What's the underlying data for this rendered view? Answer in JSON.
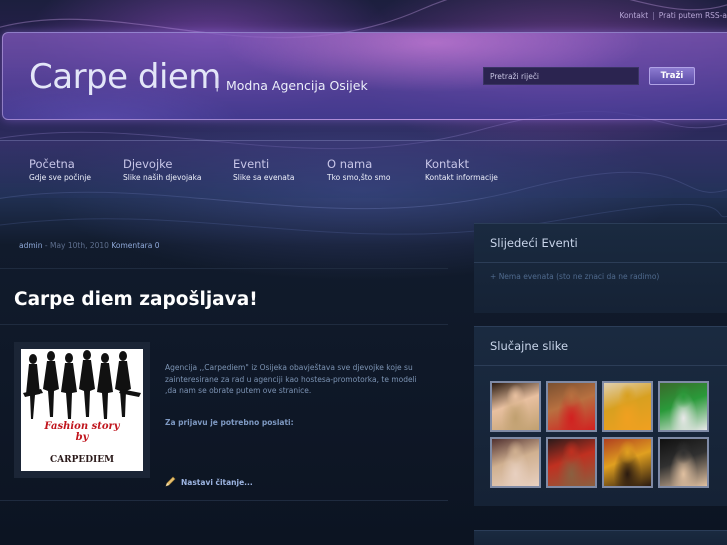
{
  "top_links": {
    "contact": "Kontakt",
    "separator": "|",
    "rss": "Prati putem RSS-a"
  },
  "header": {
    "title": "Carpe diem",
    "separator": "|",
    "subtitle": "Modna Agencija Osijek",
    "search_placeholder": "Pretraži riječi",
    "search_button": "Traži"
  },
  "nav": [
    {
      "title": "Početna",
      "subtitle": "Gdje sve počinje"
    },
    {
      "title": "Djevojke",
      "subtitle": "Slike naših djevojaka"
    },
    {
      "title": "Eventi",
      "subtitle": "Slike sa evenata"
    },
    {
      "title": "O nama",
      "subtitle": "Tko smo,što smo"
    },
    {
      "title": "Kontakt",
      "subtitle": "Kontakt informacije"
    }
  ],
  "post": {
    "author": "admin",
    "date": " - May 10th, 2010 ",
    "comments": "Komentara 0",
    "title": "Carpe diem zapošljava!",
    "thumbnail": {
      "line1": "Fashion story",
      "line2": "by",
      "line3": "CARPEDIEM"
    },
    "body": "Agencija ,,Carpediem\" iz Osijeka obavještava sve djevojke koje su zainteresirane za rad u agenciji kao hostesa-promotorka, te modeli ,da nam se obrate putem ove stranice.",
    "requirement": "Za prijavu je potrebno poslati:",
    "read_more": "Nastavi čitanje..."
  },
  "sidebar": {
    "events_title": "Slijedeći Eventi",
    "events_bullet": "+",
    "events_empty": "Nema evenata (sto ne znaci da ne radimo)",
    "photos_title": "Slučajne slike",
    "photos": [
      {
        "colors": [
          "#e8c0a0",
          "#c0a070",
          "#2a1a10"
        ]
      },
      {
        "colors": [
          "#b87040",
          "#d22020",
          "#7a5030"
        ]
      },
      {
        "colors": [
          "#d8a020",
          "#f0a020",
          "#e0d0b0"
        ]
      },
      {
        "colors": [
          "#2a9a3a",
          "#e8e8e8",
          "#3a6a2a"
        ]
      },
      {
        "colors": [
          "#d0b090",
          "#e8d0c0",
          "#503030"
        ]
      },
      {
        "colors": [
          "#c03020",
          "#8a6040",
          "#2a1a1a"
        ]
      },
      {
        "colors": [
          "#e0a020",
          "#2a1a10",
          "#b04020"
        ]
      },
      {
        "colors": [
          "#303030",
          "#e0c0a0",
          "#101010"
        ]
      }
    ]
  },
  "colors": {
    "accent": "#8c7ad0",
    "link": "#8ea8d8",
    "text_muted": "#7c93b3"
  }
}
